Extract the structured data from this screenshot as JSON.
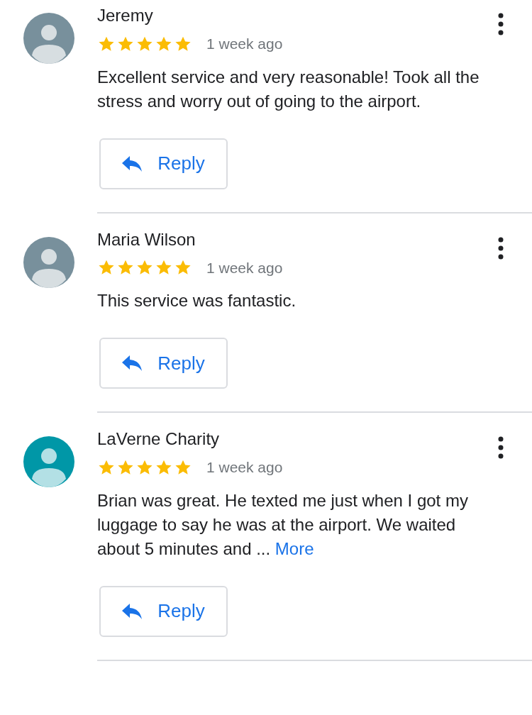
{
  "reviews": [
    {
      "name": "Jeremy",
      "color": "#78909c",
      "stars": 5,
      "time": "1 week ago",
      "text": "Excellent service and very reasonable! Took all the stress and worry out of going to the airport.",
      "reply_button": "Reply"
    },
    {
      "name": "Maria Wilson",
      "color": "#78909c",
      "stars": 5,
      "time": "1 week ago",
      "text": "This service was fantastic.",
      "reply_button": "Reply"
    },
    {
      "name": "LaVerne Charity",
      "color": "#0097a7",
      "stars": 5,
      "time": "1 week ago",
      "text": "Brian was great. He texted me just when I got my luggage to say he was at the airport. We waited about 5 minutes and ...",
      "more_link": "More",
      "reply_button": "Reply"
    }
  ]
}
